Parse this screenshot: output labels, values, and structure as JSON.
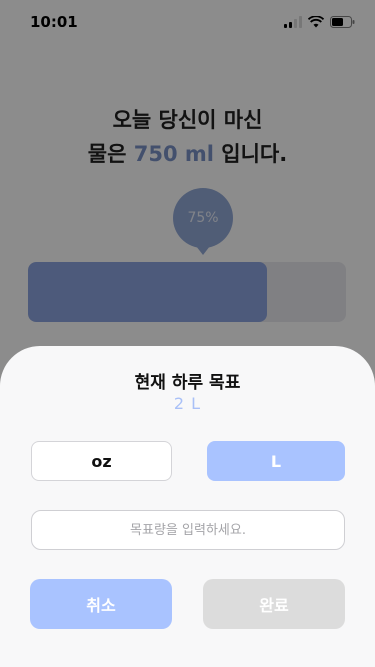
{
  "status_bar": {
    "time": "10:01"
  },
  "headline": {
    "line1": "오늘 당신이 마신",
    "line2_prefix": "물은 ",
    "amount": "750 ml",
    "line2_suffix": " 입니다."
  },
  "progress": {
    "label": "75%",
    "value": 0.75
  },
  "sheet": {
    "title": "현재 하루 목표",
    "current_goal": "2 L",
    "units": {
      "oz": "oz",
      "l": "L"
    },
    "input_placeholder": "목표량을 입력하세요.",
    "cancel_label": "취소",
    "done_label": "완료"
  },
  "colors": {
    "accent": "#a9c3ff",
    "amount_text": "#7b93c6",
    "disabled": "#dcdcdc"
  }
}
